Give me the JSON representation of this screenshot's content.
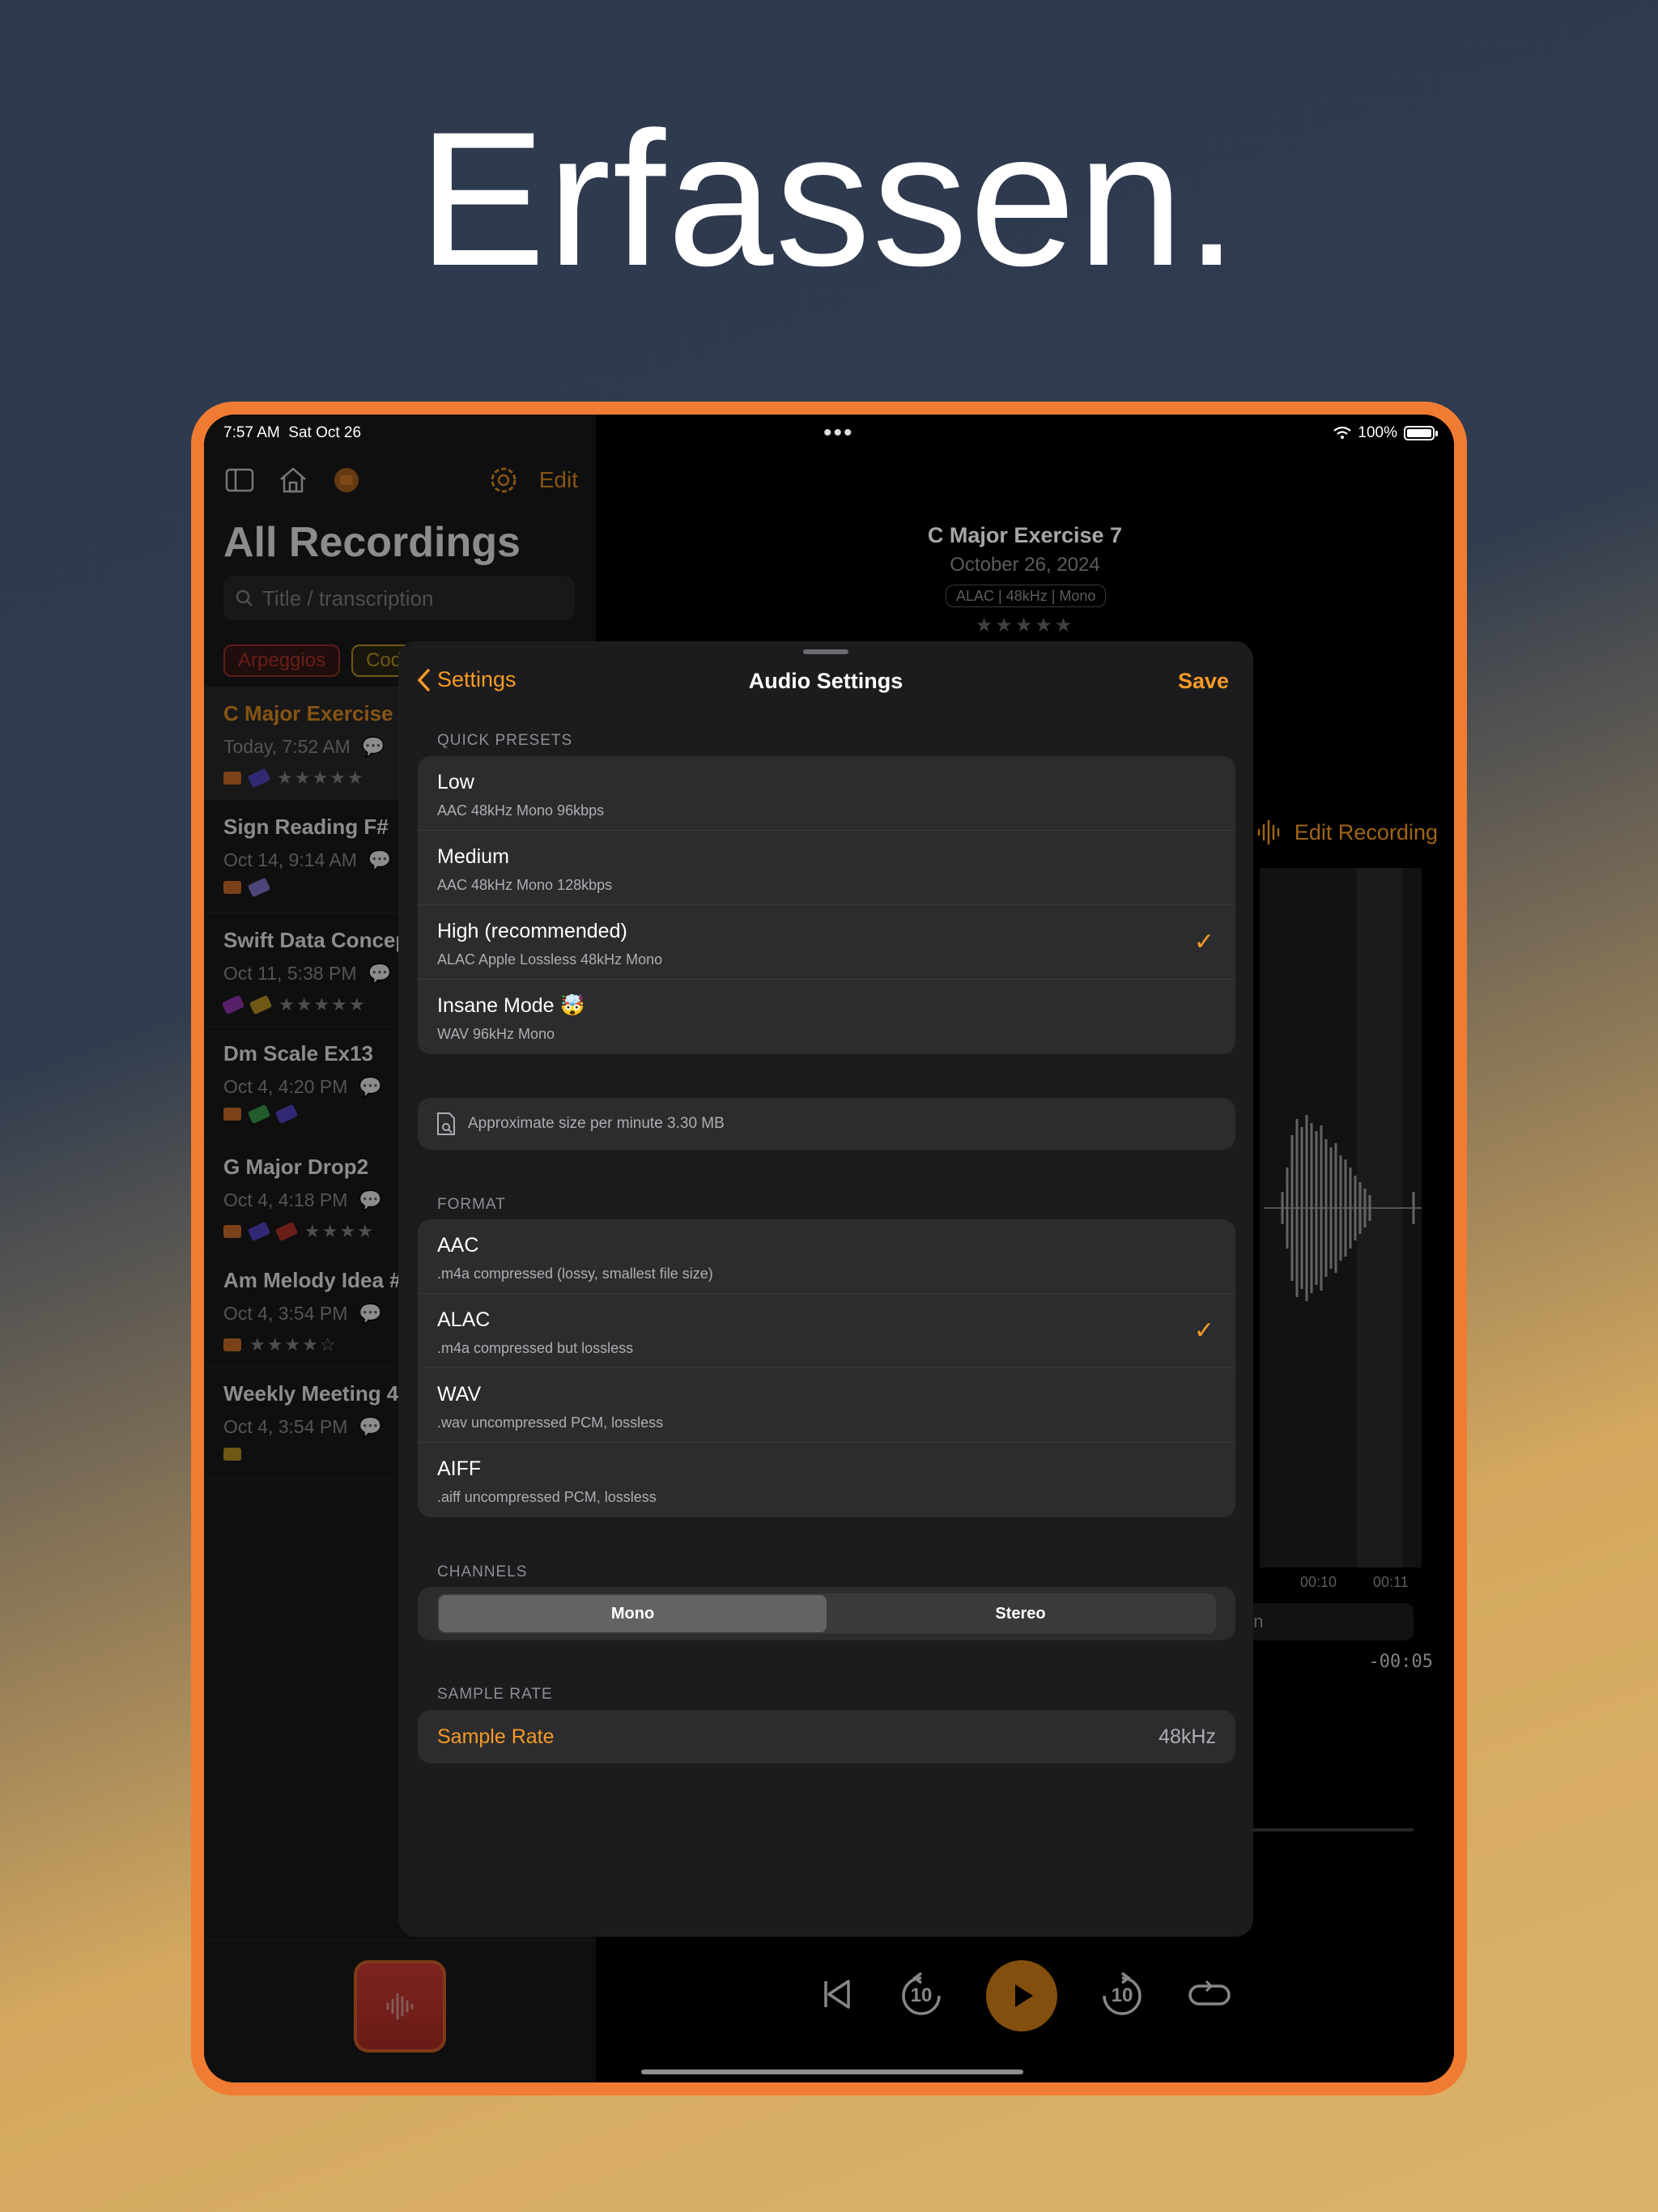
{
  "headline": "Erfassen.",
  "status": {
    "time": "7:57 AM",
    "date": "Sat Oct 26",
    "battery": "100%"
  },
  "colors": {
    "accent": "#f59a25",
    "device_frame": "#f07c33",
    "record_red": "#e2433a"
  },
  "sidebar": {
    "edit_label": "Edit",
    "title": "All Recordings",
    "search_placeholder": "Title / transcription",
    "chips": [
      {
        "label": "Arpeggios",
        "color": "#c0392b"
      },
      {
        "label": "Codin",
        "color": "#c9a227"
      },
      {
        "label": "",
        "color": "#4b4bcc"
      },
      {
        "label": "",
        "color": "#8e44ad"
      }
    ],
    "recordings": [
      {
        "title": "C Major Exercise 7",
        "date": "Today, 7:52 AM",
        "stars": "★★★★★"
      },
      {
        "title": "Sign Reading F#",
        "date": "Oct 14, 9:14 AM",
        "stars": ""
      },
      {
        "title": "Swift Data Concep",
        "date": "Oct 11, 5:38 PM",
        "stars": "★★★★★"
      },
      {
        "title": "Dm Scale Ex13",
        "date": "Oct 4, 4:20 PM",
        "stars": ""
      },
      {
        "title": "G Major Drop2",
        "date": "Oct 4, 4:18 PM",
        "stars": "★★★★"
      },
      {
        "title": "Am Melody Idea #",
        "date": "Oct 4, 3:54 PM",
        "stars": "★★★★☆"
      },
      {
        "title": "Weekly Meeting 4",
        "date": "Oct 4, 3:54 PM",
        "stars": ""
      }
    ]
  },
  "detail": {
    "title": "C Major Exercise 7",
    "date": "October 26, 2024",
    "meta": "ALAC | 48kHz | Mono",
    "stars": "★★★★★",
    "edit_label": "Edit Recording",
    "tick_1": "00:10",
    "tick_2": "00:11",
    "bar_text": "on",
    "remaining": "-00:05",
    "skip_seconds": "10"
  },
  "sheet": {
    "back_label": "Settings",
    "title": "Audio Settings",
    "save_label": "Save",
    "quick_presets_label": "QUICK PRESETS",
    "presets": [
      {
        "title": "Low",
        "sub": "AAC  48kHz  Mono  96kbps",
        "selected": false
      },
      {
        "title": "Medium",
        "sub": "AAC  48kHz  Mono  128kbps",
        "selected": false
      },
      {
        "title": "High (recommended)",
        "sub": "ALAC Apple Lossless  48kHz  Mono",
        "selected": true
      },
      {
        "title": "Insane Mode 🤯",
        "sub": "WAV  96kHz  Mono",
        "selected": false
      }
    ],
    "size_info": "Approximate size per minute 3.30 MB",
    "format_label": "FORMAT",
    "formats": [
      {
        "title": "AAC",
        "sub": ".m4a compressed (lossy, smallest file size)",
        "selected": false
      },
      {
        "title": "ALAC",
        "sub": ".m4a compressed but lossless",
        "selected": true
      },
      {
        "title": "WAV",
        "sub": ".wav uncompressed PCM, lossless",
        "selected": false
      },
      {
        "title": "AIFF",
        "sub": ".aiff uncompressed PCM, lossless",
        "selected": false
      }
    ],
    "channels_label": "CHANNELS",
    "channels": {
      "mono": "Mono",
      "stereo": "Stereo",
      "selected": "Mono"
    },
    "sample_rate_section": "SAMPLE RATE",
    "sample_rate_label": "Sample Rate",
    "sample_rate_value": "48kHz"
  }
}
